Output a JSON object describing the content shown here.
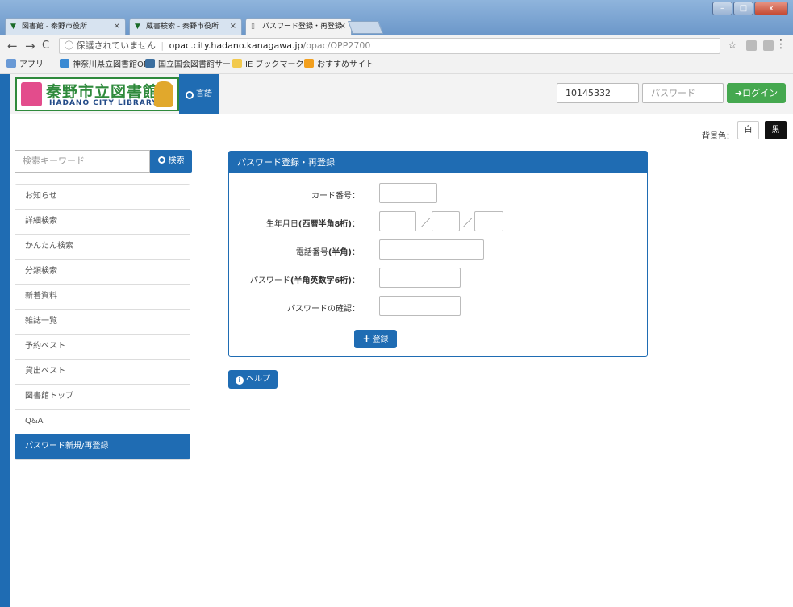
{
  "browser": {
    "tabs": [
      {
        "label": "図書館 - 秦野市役所",
        "close": "×"
      },
      {
        "label": "蔵書検索 - 秦野市役所",
        "close": "×"
      },
      {
        "label": "パスワード登録・再登録",
        "close": "×"
      }
    ],
    "window_buttons": {
      "minimize": "–",
      "maximize": "□",
      "close": "x"
    },
    "nav": {
      "back": "←",
      "forward": "→",
      "reload": "C"
    },
    "address": {
      "security": "ⓘ 保護されていません",
      "separator": "|",
      "host": "opac.city.hadano.kanagawa.jp",
      "path": "/opac/OPP2700"
    },
    "bookmark_star": "☆",
    "menu": "⋮",
    "bookmarks": [
      {
        "label": "アプリ",
        "icon": "apps-icon"
      },
      {
        "label": "神奈川県立図書館OP",
        "icon": "kanagawa-icon"
      },
      {
        "label": "国立国会図書館サー",
        "icon": "ndl-icon"
      },
      {
        "label": "IE ブックマーク",
        "icon": "folder-icon"
      },
      {
        "label": "おすすめサイト",
        "icon": "bing-icon"
      }
    ]
  },
  "header": {
    "logo_title": "秦野市立図書館",
    "logo_sub": "HADANO CITY LIBRARY",
    "language_button": "言語",
    "card_number_value": "10145332",
    "password_placeholder": "パスワード",
    "login_button": "ログイン"
  },
  "background_color": {
    "label": "背景色：",
    "white": "白",
    "black": "黒"
  },
  "search": {
    "placeholder": "検索キーワード",
    "button": "検索"
  },
  "sidebar": {
    "items": [
      {
        "label": "お知らせ"
      },
      {
        "label": "詳細検索"
      },
      {
        "label": "かんたん検索"
      },
      {
        "label": "分類検索"
      },
      {
        "label": "新着資料"
      },
      {
        "label": "雑誌一覧"
      },
      {
        "label": "予約ベスト"
      },
      {
        "label": "貸出ベスト"
      },
      {
        "label": "図書館トップ"
      },
      {
        "label": "Q&A"
      },
      {
        "label": "パスワード新規/再登録"
      }
    ],
    "active_index": 10
  },
  "form": {
    "title": "パスワード登録・再登録",
    "card_label": "カード番号：",
    "birth_label_plain": "生年月日",
    "birth_label_bold": "(西暦半角8桁)",
    "birth_label_colon": "：",
    "date_separator": "／",
    "phone_label_plain": "電話番号",
    "phone_label_bold": "(半角)",
    "phone_label_colon": "：",
    "password_label_plain": "パスワード",
    "password_label_bold": "(半角英数字6桁)",
    "password_label_colon": "：",
    "confirm_label": "パスワードの確認：",
    "register_button": "登録"
  },
  "help_button": "ヘルプ",
  "colors": {
    "primary": "#1f6cb3",
    "login_green": "#45a84f",
    "logo_green": "#2f8a3c"
  }
}
